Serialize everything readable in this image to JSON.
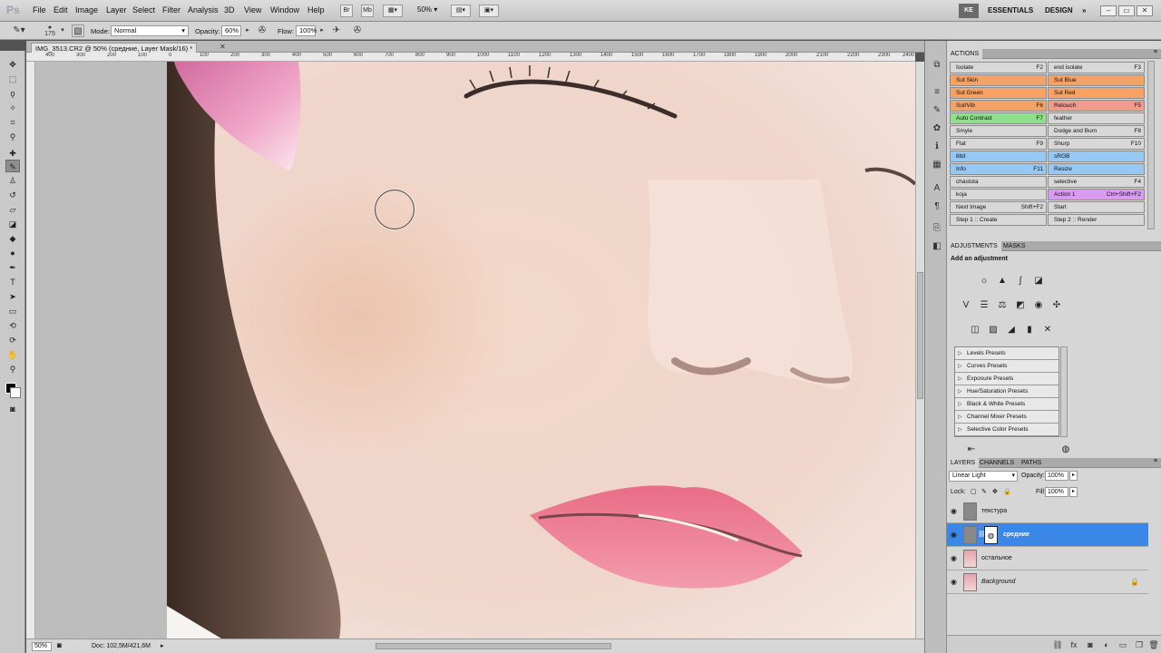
{
  "app": {
    "logo": "Ps",
    "menus": [
      "File",
      "Edit",
      "Image",
      "Layer",
      "Select",
      "Filter",
      "Analysis",
      "3D",
      "View",
      "Window",
      "Help"
    ],
    "bridge_label": "Br",
    "mini_bridge_label": "Mb",
    "zoom_level": "50%",
    "user_badge": "KE",
    "workspaces": [
      "ESSENTIALS",
      "DESIGN"
    ],
    "more_label": "»"
  },
  "options": {
    "brush_size": "175",
    "mode_label": "Mode:",
    "mode_value": "Normal",
    "opacity_label": "Opacity:",
    "opacity_value": "60%",
    "flow_label": "Flow:",
    "flow_value": "100%"
  },
  "document": {
    "tab_title": "IMG_3513.CR2 @ 50% (средние, Layer Mask/16) *",
    "ruler_ticks": [
      "400",
      "300",
      "200",
      "100",
      "0",
      "100",
      "200",
      "300",
      "400",
      "500",
      "600",
      "700",
      "800",
      "900",
      "1000",
      "1100",
      "1200",
      "1300",
      "1400",
      "1500",
      "1600",
      "1700",
      "1800",
      "1900",
      "2000",
      "2100",
      "2200",
      "2300",
      "2400"
    ],
    "status_zoom": "50%",
    "status_doc": "Doc: 102,5M/421,6M"
  },
  "actions": {
    "title": "ACTIONS",
    "rows": [
      [
        {
          "name": "Isolate",
          "key": "F2",
          "color": "#d8d8d8"
        },
        {
          "name": "end isolate",
          "key": "F3",
          "color": "#d8d8d8"
        }
      ],
      [
        {
          "name": "Sut Skin",
          "key": "",
          "color": "#f5a266"
        },
        {
          "name": "Sut Blue",
          "key": "",
          "color": "#f5a266"
        }
      ],
      [
        {
          "name": "Sut Green",
          "key": "",
          "color": "#f5a266"
        },
        {
          "name": "Sut Red",
          "key": "",
          "color": "#f5a266"
        }
      ],
      [
        {
          "name": "Sut/Vib",
          "key": "F6",
          "color": "#f5a266"
        },
        {
          "name": "Retouch",
          "key": "F5",
          "color": "#f39a8e"
        }
      ],
      [
        {
          "name": "Auto Contrast",
          "key": "F7",
          "color": "#8ee08a"
        },
        {
          "name": "feather",
          "key": "",
          "color": "#d8d8d8"
        }
      ],
      [
        {
          "name": "Smyle",
          "key": "",
          "color": "#d8d8d8"
        },
        {
          "name": "Dodge and Burn",
          "key": "F8",
          "color": "#d8d8d8"
        }
      ],
      [
        {
          "name": "Flat",
          "key": "F9",
          "color": "#d8d8d8"
        },
        {
          "name": "Shurp",
          "key": "F10",
          "color": "#d8d8d8"
        }
      ],
      [
        {
          "name": "8bit",
          "key": "",
          "color": "#95c8f5"
        },
        {
          "name": "sRGB",
          "key": "",
          "color": "#95c8f5"
        }
      ],
      [
        {
          "name": "Info",
          "key": "F11",
          "color": "#95c8f5"
        },
        {
          "name": "Resize",
          "key": "",
          "color": "#95c8f5"
        }
      ],
      [
        {
          "name": "chastota",
          "key": "",
          "color": "#d8d8d8"
        },
        {
          "name": "selective",
          "key": "F4",
          "color": "#d8d8d8"
        }
      ],
      [
        {
          "name": "koja",
          "key": "",
          "color": "#d8d8d8"
        },
        {
          "name": "Action 1",
          "key": "Ctrl+Shift+F2",
          "color": "#d99cf2"
        }
      ],
      [
        {
          "name": "Next Image",
          "key": "Shift+F2",
          "color": "#d8d8d8"
        },
        {
          "name": "Start",
          "key": "",
          "color": "#d8d8d8"
        }
      ],
      [
        {
          "name": "Step 1 :: Create",
          "key": "",
          "color": "#d8d8d8"
        },
        {
          "name": "Step 2 :: Render",
          "key": "",
          "color": "#d8d8d8"
        }
      ]
    ]
  },
  "adjustments": {
    "tabs": [
      "ADJUSTMENTS",
      "MASKS"
    ],
    "title": "Add an adjustment",
    "presets": [
      "Levels Presets",
      "Curves Presets",
      "Exposure Presets",
      "Hue/Saturation Presets",
      "Black & White Presets",
      "Channel Mixer Presets",
      "Selective Color Presets"
    ]
  },
  "layers": {
    "tabs": [
      "LAYERS",
      "CHANNELS",
      "PATHS"
    ],
    "blend_mode": "Linear Light",
    "opacity_label": "Opacity:",
    "opacity_value": "100%",
    "lock_label": "Lock:",
    "fill_label": "Fill:",
    "fill_value": "100%",
    "items": [
      {
        "name": "текстура",
        "selected": false,
        "locked": false
      },
      {
        "name": "средние",
        "selected": true,
        "locked": false
      },
      {
        "name": "остальное",
        "selected": false,
        "locked": false
      },
      {
        "name": "Background",
        "selected": false,
        "locked": true
      }
    ]
  },
  "colors": {
    "selection": "#3b87e8",
    "lip": "#ea7c92",
    "skin": "#f1dcd2"
  }
}
